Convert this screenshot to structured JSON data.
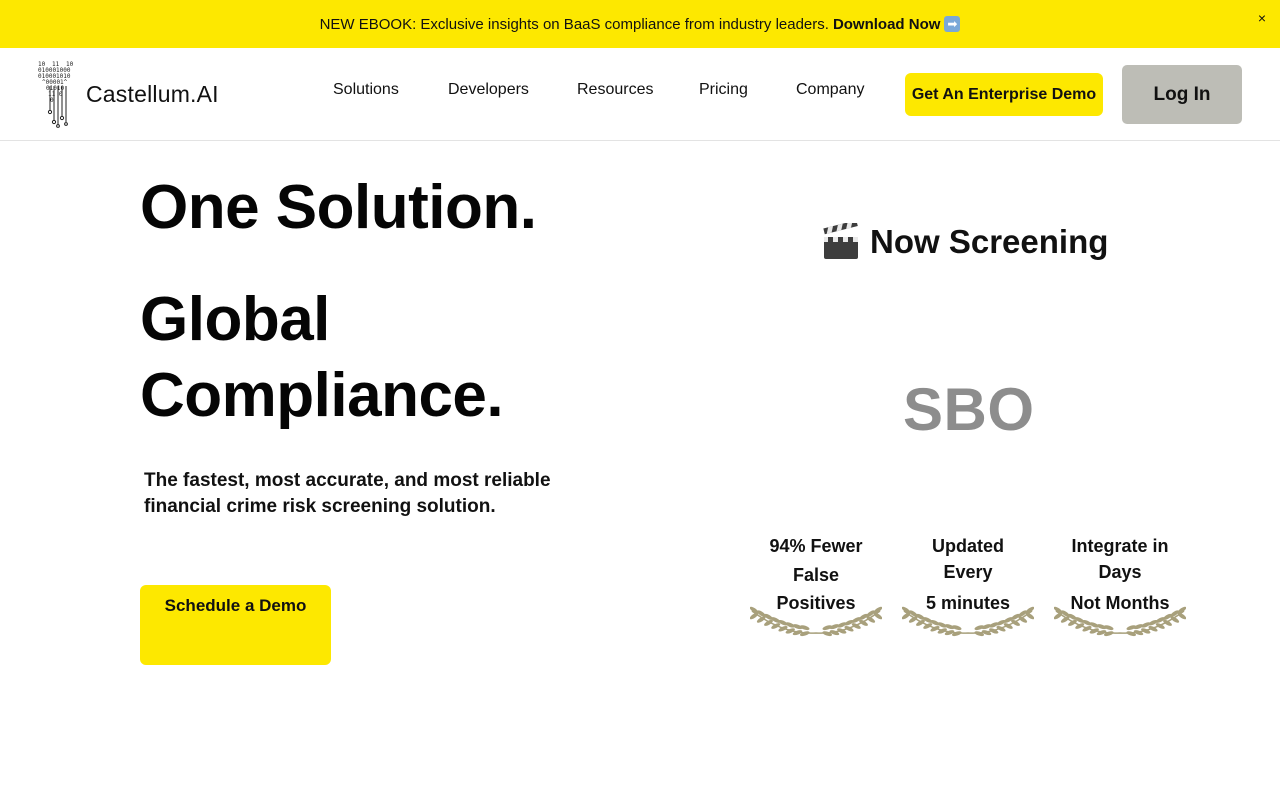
{
  "banner": {
    "text": "NEW EBOOK: Exclusive insights on BaaS compliance from industry leaders.",
    "cta": "Download Now",
    "arrow": "➡",
    "close": "×",
    "color": "#fde800"
  },
  "nav": {
    "brand": "Castellum.AI",
    "items": [
      "Solutions",
      "Developers",
      "Resources",
      "Pricing",
      "Company"
    ],
    "demo_button": "Get An Enterprise Demo",
    "login_button": "Log In"
  },
  "hero": {
    "title_line1": "One Solution.",
    "title_line2": "Global Compliance.",
    "subtitle": "The fastest, most accurate, and most reliable financial crime risk screening solution.",
    "cta": "Schedule a Demo"
  },
  "screening": {
    "icon": "clapperboard-icon",
    "label": "Now Screening",
    "acronym": "SBO"
  },
  "awards": [
    {
      "lines": [
        "94% Fewer",
        "False",
        "Positives"
      ]
    },
    {
      "lines": [
        "Updated",
        "Every",
        "5 minutes"
      ]
    },
    {
      "lines": [
        "Integrate in",
        "Days",
        "Not Months"
      ]
    }
  ],
  "colors": {
    "accent_yellow": "#fde800",
    "login_gray": "#bdbdb6",
    "acronym_gray": "#8d8d8d",
    "laurel": "#a8a07c"
  }
}
